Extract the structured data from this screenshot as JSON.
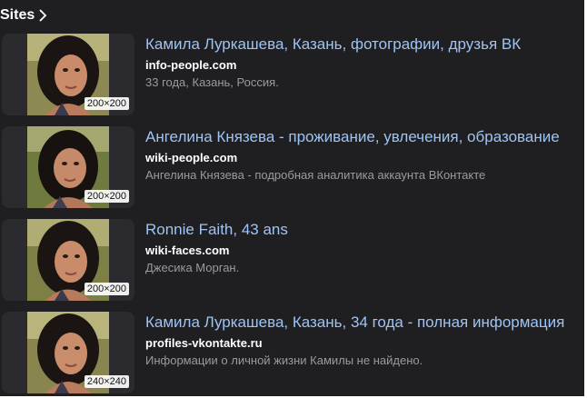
{
  "header": {
    "title": "Sites",
    "chevron_icon": "chevron-right-icon"
  },
  "results": [
    {
      "title": "Камила Луркашева, Казань, фотографии, друзья ВК",
      "domain": "info-people.com",
      "snippet": "33 года, Казань, Россия.",
      "size": "200×200"
    },
    {
      "title": "Ангелина Князева - проживание, увлечения, образование",
      "domain": "wiki-people.com",
      "snippet": "Ангелина Князева - подробная аналитика аккаунта ВКонтакте",
      "size": "200×200"
    },
    {
      "title": "Ronnie Faith, 43 ans",
      "domain": "wiki-faces.com",
      "snippet": "Джесика Морган.",
      "size": "200×200"
    },
    {
      "title": "Камила Луркашева, Казань, 34 года - полная информация",
      "domain": "profiles-vkontakte.ru",
      "snippet": "Информации о личной жизни Камилы не найдено.",
      "size": "240×240"
    }
  ],
  "colors": {
    "background": "#1f1f22",
    "title_link": "#9dc4f5",
    "domain": "#ffffff",
    "snippet": "#9a9a9f",
    "thumb_bg": "#2b2b2f"
  }
}
